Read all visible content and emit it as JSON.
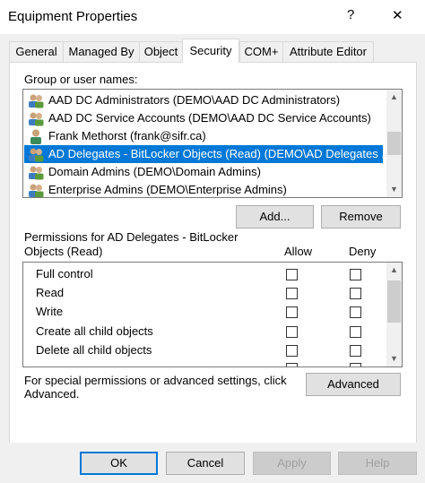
{
  "window": {
    "title": "Equipment Properties",
    "help_glyph": "?",
    "close_glyph": "✕"
  },
  "tabs": [
    {
      "label": "General"
    },
    {
      "label": "Managed By"
    },
    {
      "label": "Object"
    },
    {
      "label": "Security"
    },
    {
      "label": "COM+"
    },
    {
      "label": "Attribute Editor"
    }
  ],
  "groups": {
    "label": "Group or user names:",
    "items": [
      {
        "name": "AAD DC Administrators (DEMO\\AAD DC Administrators)",
        "icon": "group-icon",
        "selected": false
      },
      {
        "name": "AAD DC Service Accounts (DEMO\\AAD DC Service Accounts)",
        "icon": "group-icon",
        "selected": false
      },
      {
        "name": "Frank Methorst (frank@sifr.ca)",
        "icon": "user-icon",
        "selected": false
      },
      {
        "name": "AD Delegates - BitLocker Objects (Read) (DEMO\\AD Delegates ...",
        "icon": "group-icon",
        "selected": true
      },
      {
        "name": "Domain Admins (DEMO\\Domain Admins)",
        "icon": "group-icon",
        "selected": false
      },
      {
        "name": "Enterprise Admins (DEMO\\Enterprise Admins)",
        "icon": "group-icon",
        "selected": false
      }
    ],
    "add_label": "Add...",
    "remove_label": "Remove"
  },
  "permissions": {
    "label_line1": "Permissions for AD Delegates - BitLocker",
    "label_line2": "Objects (Read)",
    "allow_label": "Allow",
    "deny_label": "Deny",
    "items": [
      {
        "name": "Full control",
        "allow": false,
        "deny": false
      },
      {
        "name": "Read",
        "allow": false,
        "deny": false
      },
      {
        "name": "Write",
        "allow": false,
        "deny": false
      },
      {
        "name": "Create all child objects",
        "allow": false,
        "deny": false
      },
      {
        "name": "Delete all child objects",
        "allow": false,
        "deny": false
      }
    ]
  },
  "advanced": {
    "text_line1": "For special permissions or advanced settings, click",
    "text_line2": "Advanced.",
    "button_label": "Advanced"
  },
  "footer": {
    "ok_label": "OK",
    "cancel_label": "Cancel",
    "apply_label": "Apply",
    "help_label": "Help"
  },
  "colors": {
    "selection": "#0078d7",
    "default_button_border": "#0078d7"
  }
}
